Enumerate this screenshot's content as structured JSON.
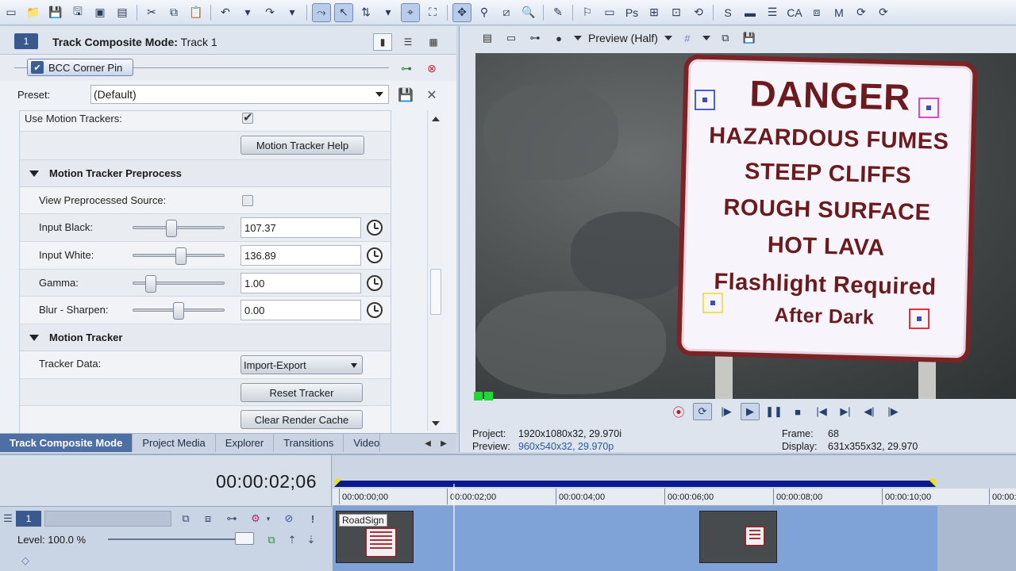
{
  "fx_window": {
    "track_number": "1",
    "title_bold": "Track Composite Mode:",
    "title_rest": " Track 1",
    "plugin_name": "BCC Corner Pin",
    "preset_label": "Preset:",
    "preset_value": "(Default)"
  },
  "params": {
    "use_motion_trackers_label": "Use Motion Trackers:",
    "use_motion_trackers_checked": true,
    "motion_tracker_help_button": "Motion Tracker Help",
    "section_preprocess": "Motion Tracker Preprocess",
    "view_preprocessed_label": "View Preprocessed Source:",
    "view_preprocessed_checked": false,
    "sliders": [
      {
        "label": "Input Black:",
        "value": "107.37",
        "position": 0.43
      },
      {
        "label": "Input White:",
        "value": "136.89",
        "position": 0.53
      },
      {
        "label": "Gamma:",
        "value": "1.00",
        "position": 0.2
      },
      {
        "label": "Blur - Sharpen:",
        "value": "0.00",
        "position": 0.5
      }
    ],
    "section_tracker": "Motion Tracker",
    "tracker_data_label": "Tracker Data:",
    "tracker_data_value": "Import-Export",
    "reset_tracker_button": "Reset Tracker",
    "clear_render_cache_button": "Clear Render Cache"
  },
  "tabs": [
    "Track Composite Mode",
    "Project Media",
    "Explorer",
    "Transitions",
    "Video"
  ],
  "preview": {
    "quality_label": "Preview (Half)",
    "sign_lines": [
      "DANGER",
      "HAZARDOUS FUMES",
      "STEEP CLIFFS",
      "ROUGH SURFACE",
      "HOT LAVA",
      "Flashlight Required",
      "After Dark"
    ],
    "project_label": "Project:",
    "project_value": "1920x1080x32, 29.970i",
    "preview_label": "Preview:",
    "preview_value": "960x540x32, 29.970p",
    "frame_label": "Frame:",
    "frame_value": "68",
    "display_label": "Display:",
    "display_value": "631x355x32, 29.970"
  },
  "timeline": {
    "timecode": "00:00:02;06",
    "track_number": "1",
    "level_label": "Level: 100.0 %",
    "clip_name": "RoadSign",
    "ruler": [
      "00:00:00;00",
      "00:00:02;00",
      "00:00:04;00",
      "00:00:06;00",
      "00:00:08;00",
      "00:00:10;00",
      "00:00:1"
    ]
  },
  "colors": {
    "accent": "#3a5a8f",
    "active_tab": "#4d6fa5",
    "loop_bar": "#0a1a8c",
    "sign_text": "#6b1a1d"
  }
}
